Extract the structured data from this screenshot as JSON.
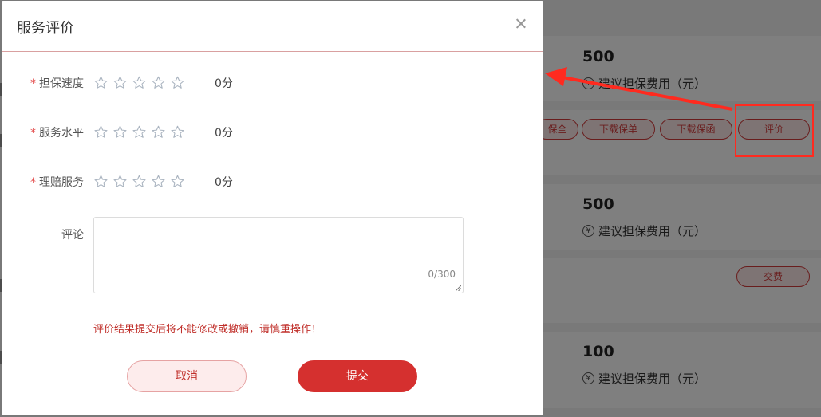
{
  "dialog": {
    "title": "服务评价",
    "ratings": [
      {
        "required_mark": "*",
        "label": "担保速度",
        "stars_total": 5,
        "stars_filled": 0,
        "score": "0分"
      },
      {
        "required_mark": "*",
        "label": "服务水平",
        "stars_total": 5,
        "stars_filled": 0,
        "score": "0分"
      },
      {
        "required_mark": "*",
        "label": "理赔服务",
        "stars_total": 5,
        "stars_filled": 0,
        "score": "0分"
      }
    ],
    "comment": {
      "label": "评论",
      "value": "",
      "placeholder": "",
      "counter": "0/300"
    },
    "warning": "评价结果提交后将不能修改或撤销，请慎重操作！",
    "cancel_label": "取消",
    "submit_label": "提交"
  },
  "background": {
    "cards": [
      {
        "amount": "500",
        "fee_label": "建议担保费用（元）"
      },
      {
        "amount": "500",
        "fee_label": "建议担保费用（元）"
      },
      {
        "amount": "100",
        "fee_label": "建议担保费用（元）"
      }
    ],
    "actions": {
      "preserve_partial": "保全",
      "download_policy": "下载保单",
      "download_letter": "下载保函",
      "evaluate": "评价",
      "pay": "交费"
    }
  },
  "colors": {
    "accent": "#d5302f",
    "annotation": "#ff2a1f",
    "star_outline": "#aab4c0"
  }
}
